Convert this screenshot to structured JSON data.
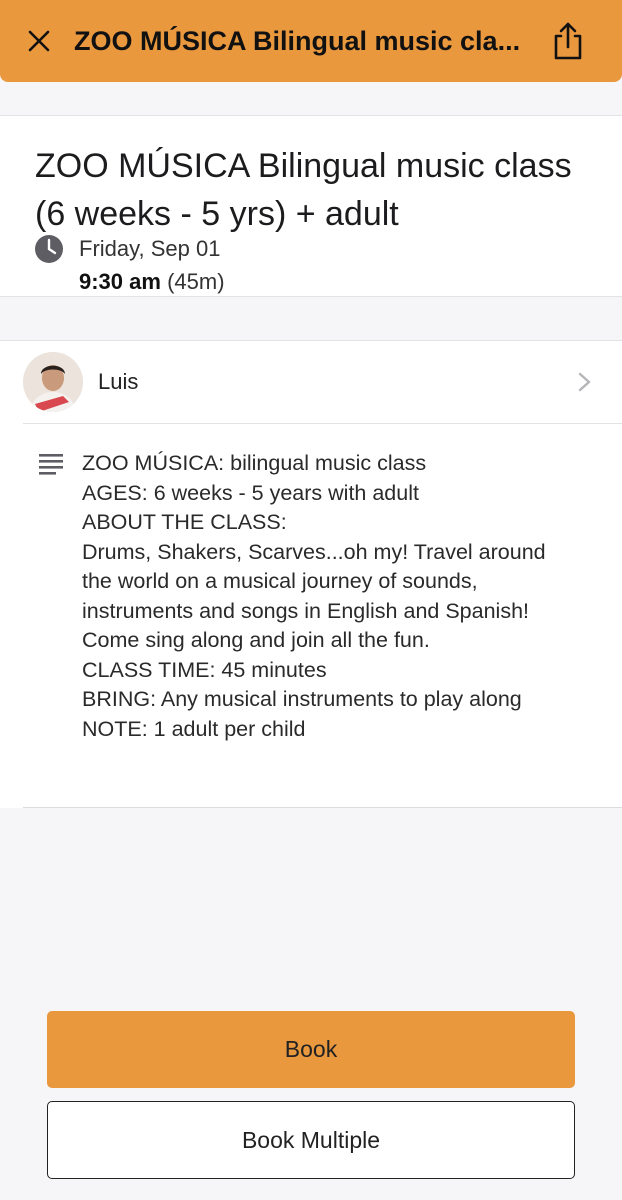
{
  "header": {
    "title": "ZOO MÚSICA Bilingual music cla...",
    "close_icon": "close-icon",
    "share_icon": "share-icon",
    "accent_color": "#e9983e"
  },
  "event": {
    "title": "ZOO MÚSICA Bilingual music class (6 weeks - 5 yrs) + adult",
    "date": "Friday, Sep 01",
    "time": "9:30 am",
    "duration": "(45m)"
  },
  "instructor": {
    "name": "Luis"
  },
  "description": {
    "lines": [
      "ZOO MÚSICA: bilingual music class",
      "AGES: 6 weeks - 5 years with adult",
      "ABOUT THE CLASS:",
      "Drums, Shakers, Scarves...oh my! Travel around",
      "the world on a musical journey of sounds,",
      "instruments and songs in English and Spanish!",
      "Come sing along and join all the fun.",
      "CLASS TIME: 45 minutes",
      "BRING: Any musical instruments to play along",
      "NOTE: 1 adult per child"
    ]
  },
  "actions": {
    "book_label": "Book",
    "book_multiple_label": "Book Multiple"
  }
}
